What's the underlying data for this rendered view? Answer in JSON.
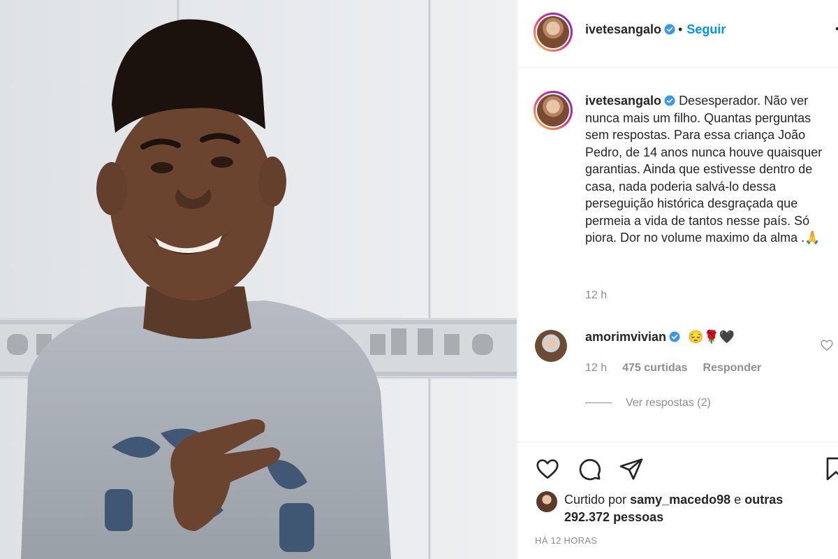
{
  "post": {
    "author": "ivetesangalo",
    "follow_label": "Seguir",
    "caption": "Desesperador. Não ver nunca mais um filho. Quantas perguntas sem respostas. Para essa criança João Pedro, de 14 anos nunca houve quaisquer garantias. Ainda que estivesse dentro de casa, nada poderia salvá-lo dessa perseguição histórica desgraçada que permeia a vida de tantos nesse país. Só piora. Dor no volume maximo da alma .",
    "caption_emoji": "🙏",
    "caption_time": "12 h"
  },
  "comment": {
    "author": "amorimvivian",
    "emojis": "😔🌹🖤",
    "time": "12 h",
    "likes": "475 curtidas",
    "reply_label": "Responder",
    "view_replies": "Ver respostas (2)"
  },
  "likes": {
    "prefix": "Curtido por",
    "first_user": "samy_macedo98",
    "conj": "e",
    "others": "outras 292.372 pessoas"
  },
  "timestamp": "HÁ 12 HORAS",
  "icons": {
    "verified": "verified-badge-icon",
    "more": "more-options-icon",
    "like": "heart-icon",
    "comment": "comment-icon",
    "share": "paper-plane-icon",
    "save": "bookmark-icon",
    "comment_like": "small-heart-icon"
  },
  "colors": {
    "link_blue": "#0095f6",
    "verified_blue": "#3897f0",
    "text": "#262626",
    "muted": "#8e8e8e"
  }
}
